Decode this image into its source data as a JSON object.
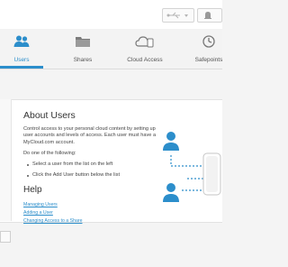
{
  "nav": {
    "items": [
      {
        "label": "Users",
        "icon": "users-icon",
        "active": true
      },
      {
        "label": "Shares",
        "icon": "folder-icon",
        "active": false
      },
      {
        "label": "Cloud Access",
        "icon": "cloud-icon",
        "active": false
      },
      {
        "label": "Safepoints",
        "icon": "safepoint-icon",
        "active": false
      }
    ]
  },
  "colors": {
    "accent": "#2c8ecb"
  },
  "about": {
    "title": "About Users",
    "intro": "Control access to your personal cloud content by setting up user accounts and levels of access. Each user must have a MyCloud.com account.",
    "do_one": "Do one of the following:",
    "options": [
      "Select a user from the list on the left",
      "Click the Add User button below the list"
    ]
  },
  "help": {
    "title": "Help",
    "links": [
      "Managing Users",
      "Adding a User",
      "Changing Access to a Share"
    ]
  }
}
